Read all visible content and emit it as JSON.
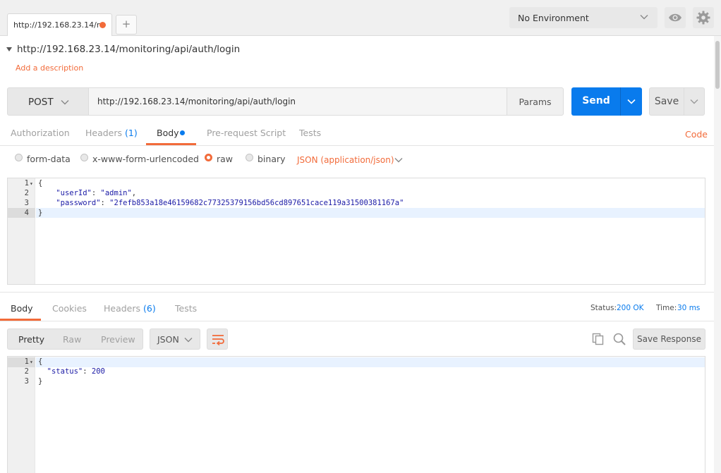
{
  "tabs": {
    "request_tab_label": "http://192.168.23.14/r",
    "add_tab_label": "+"
  },
  "environment": {
    "selected": "No Environment"
  },
  "request": {
    "title": "http://192.168.23.14/monitoring/api/auth/login",
    "add_description": "Add a description",
    "method": "POST",
    "url": "http://192.168.23.14/monitoring/api/auth/login",
    "params_label": "Params",
    "send_label": "Send",
    "save_label": "Save"
  },
  "request_tabs": {
    "authorization": "Authorization",
    "headers": "Headers",
    "headers_count": "(1)",
    "body": "Body",
    "prerequest": "Pre-request Script",
    "tests": "Tests",
    "code": "Code"
  },
  "body_types": {
    "form_data": "form-data",
    "urlencoded": "x-www-form-urlencoded",
    "raw": "raw",
    "binary": "binary",
    "content_type": "JSON (application/json)",
    "selected": "raw"
  },
  "request_body": {
    "line_numbers": [
      "1",
      "2",
      "3",
      "4"
    ],
    "brace_open": "{",
    "key1": "\"userId\"",
    "val1": "\"admin\"",
    "key2": "\"password\"",
    "val2": "\"2fefb853a18e46159682c77325379156bd56cd897651cace119a31500381167a\"",
    "brace_close": "}"
  },
  "response_tabs": {
    "body": "Body",
    "cookies": "Cookies",
    "headers": "Headers",
    "headers_count": "(6)",
    "tests": "Tests"
  },
  "response_meta": {
    "status_label": "Status:",
    "status_value": "200 OK",
    "time_label": "Time:",
    "time_value": "30 ms"
  },
  "response_view": {
    "pretty": "Pretty",
    "raw": "Raw",
    "preview": "Preview",
    "format": "JSON",
    "save_response": "Save Response"
  },
  "response_body": {
    "line_numbers": [
      "1",
      "2",
      "3"
    ],
    "brace_open": "{",
    "key1": "\"status\"",
    "val1": "200",
    "brace_close": "}"
  },
  "colors": {
    "accent_orange": "#f26b3a",
    "primary_blue": "#097bed"
  }
}
